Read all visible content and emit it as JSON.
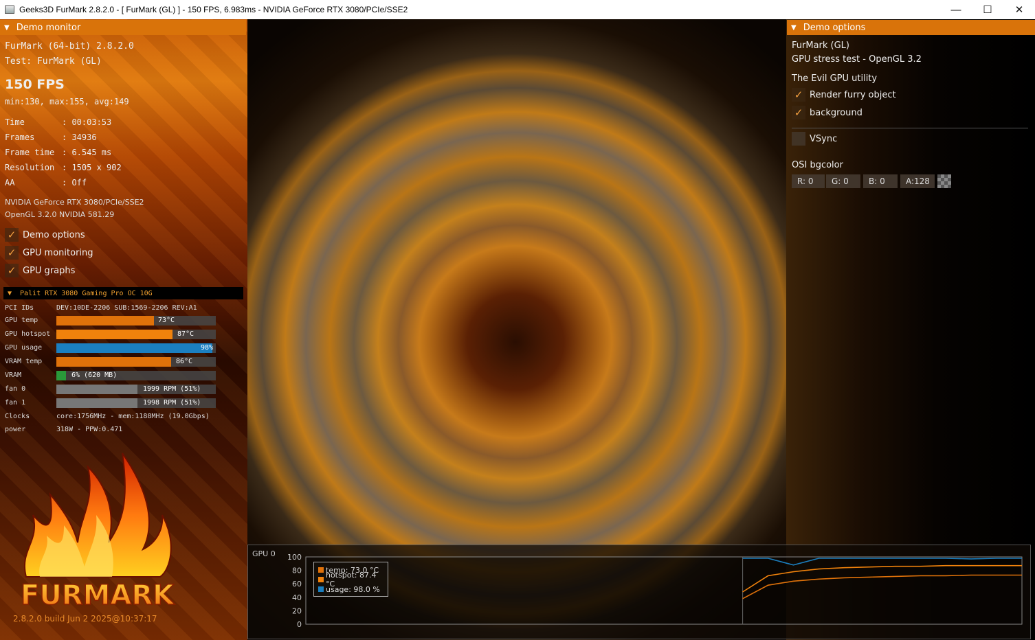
{
  "window": {
    "title": "Geeks3D FurMark 2.8.2.0 - [ FurMark (GL) ] - 150 FPS, 6.983ms - NVIDIA GeForce RTX 3080/PCIe/SSE2",
    "minimize_icon": "minimize-icon",
    "maximize_icon": "maximize-icon",
    "close_icon": "close-icon"
  },
  "demo_monitor": {
    "header": "Demo monitor",
    "app": "FurMark (64-bit) 2.8.2.0",
    "test": "Test: FurMark (GL)",
    "fps": "150 FPS",
    "fps_stats": "min:130, max:155, avg:149",
    "stats": [
      {
        "label": "Time      ",
        "value": ": 00:03:53"
      },
      {
        "label": "Frames    ",
        "value": ": 34936"
      },
      {
        "label": "Frame time",
        "value": ": 6.545 ms"
      },
      {
        "label": "Resolution",
        "value": ": 1505 x 902"
      },
      {
        "label": "AA        ",
        "value": ": Off"
      }
    ],
    "gpu_name": "NVIDIA GeForce RTX 3080/PCIe/SSE2",
    "gl_version": "OpenGL 3.2.0 NVIDIA 581.29",
    "checkboxes": [
      {
        "label": "Demo options",
        "checked": true
      },
      {
        "label": "GPU monitoring",
        "checked": true
      },
      {
        "label": "GPU graphs",
        "checked": true
      }
    ]
  },
  "gpu_monitor": {
    "header": "Palit RTX 3080 Gaming Pro OC 10G",
    "pci_label": "PCI IDs",
    "pci_value": "DEV:10DE-2206 SUB:1569-2206 REV:A1",
    "rows": [
      {
        "label": "GPU temp",
        "value": "73°C",
        "fraction": 0.61,
        "color": "#e0720a"
      },
      {
        "label": "GPU hotspot",
        "value": "87°C",
        "fraction": 0.73,
        "color": "#f0820c"
      },
      {
        "label": "GPU usage",
        "value": "98%",
        "fraction": 0.98,
        "color": "#1b7fc0"
      },
      {
        "label": "VRAM temp",
        "value": "86°C",
        "fraction": 0.72,
        "color": "#e0720a"
      },
      {
        "label": "VRAM",
        "value": "6% (620 MB)",
        "fraction": 0.06,
        "color": "#2a9a3a"
      },
      {
        "label": "fan 0",
        "value": "1999 RPM (51%)",
        "fraction": 0.51,
        "color": "#777777"
      },
      {
        "label": "fan 1",
        "value": "1998 RPM (51%)",
        "fraction": 0.51,
        "color": "#777777"
      }
    ],
    "clocks_label": "Clocks",
    "clocks_value": "core:1756MHz - mem:1188MHz (19.0Gbps)",
    "power_label": "power",
    "power_value": "318W - PPW:0.471"
  },
  "logo": {
    "text": "FURMARK"
  },
  "build": "2.8.2.0 build Jun  2 2025@10:37:17",
  "demo_options": {
    "header": "Demo options",
    "name": "FurMark (GL)",
    "desc": "GPU stress test - OpenGL 3.2",
    "utility": "The Evil GPU utility",
    "checkboxes": [
      {
        "label": "Render furry object",
        "checked": true
      },
      {
        "label": "background",
        "checked": true
      }
    ],
    "vsync": {
      "label": "VSync",
      "checked": false
    },
    "osi_label": "OSI bgcolor",
    "osi": [
      {
        "label": "R: 0"
      },
      {
        "label": "G: 0"
      },
      {
        "label": "B: 0"
      },
      {
        "label": "A:128"
      }
    ]
  },
  "graph": {
    "title": "GPU 0",
    "legend": [
      {
        "label": "temp: 73.0 °C",
        "color": "#e0720a"
      },
      {
        "label": "hotspot: 87.4 °C",
        "color": "#f0820c"
      },
      {
        "label": "usage: 98.0 %",
        "color": "#1b7fc0"
      }
    ]
  },
  "chart_data": {
    "type": "line",
    "title": "GPU 0",
    "ylim": [
      0,
      100
    ],
    "yticks": [
      "100",
      "80",
      "60",
      "40",
      "20",
      "0"
    ],
    "series": [
      {
        "name": "temp: 73.0 °C",
        "values": [
          38,
          58,
          64,
          67,
          69,
          70,
          71,
          72,
          72,
          73,
          73,
          73
        ]
      },
      {
        "name": "hotspot: 87.4 °C",
        "values": [
          48,
          72,
          78,
          82,
          84,
          85,
          86,
          86,
          87,
          87,
          87,
          87
        ]
      },
      {
        "name": "usage: 98.0 %",
        "values": [
          98,
          98,
          88,
          98,
          98,
          98,
          98,
          98,
          98,
          97,
          98,
          98
        ]
      }
    ]
  }
}
